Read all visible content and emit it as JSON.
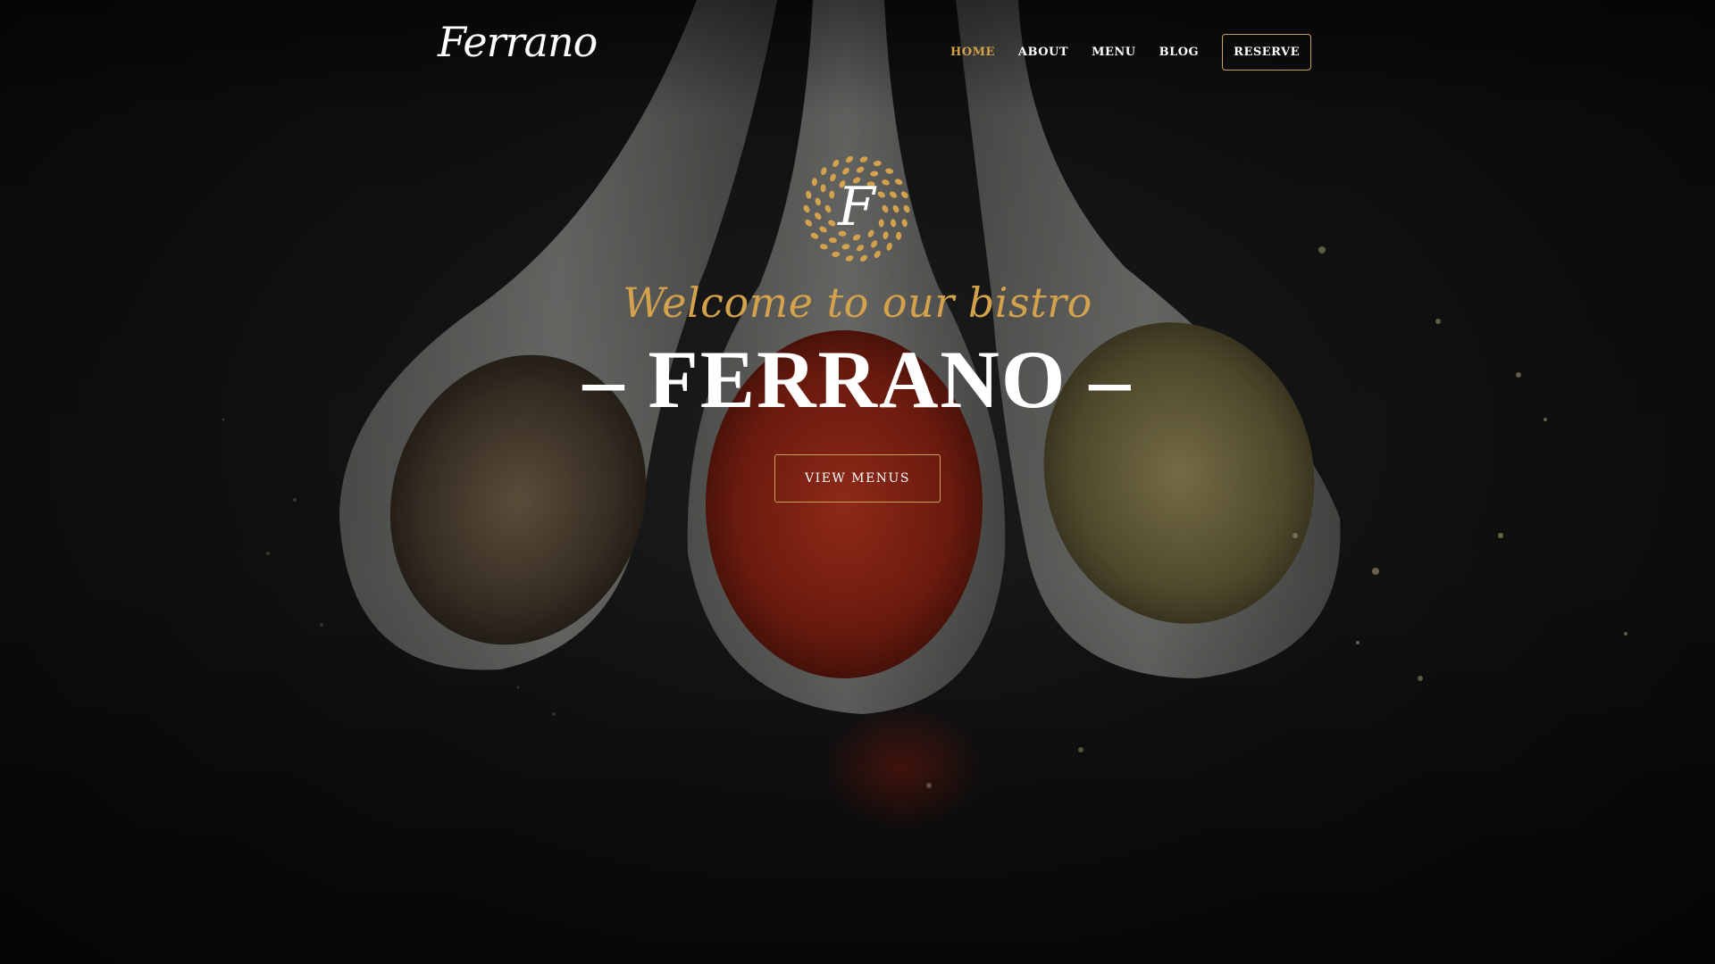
{
  "header": {
    "logo_text": "Ferrano",
    "nav_items": [
      "HOME",
      "ABOUT",
      "MENU",
      "BLOG"
    ],
    "active_nav": "HOME",
    "reserve_label": "RESERVE"
  },
  "hero": {
    "emblem_letter": "F",
    "tagline": "Welcome to our bistro",
    "title": "– FERRANO –",
    "cta_label": "VIEW MENUS"
  },
  "colors": {
    "accent_gold": "#d4a24c",
    "background": "#0c0c0c",
    "text_light": "#ffffff"
  }
}
